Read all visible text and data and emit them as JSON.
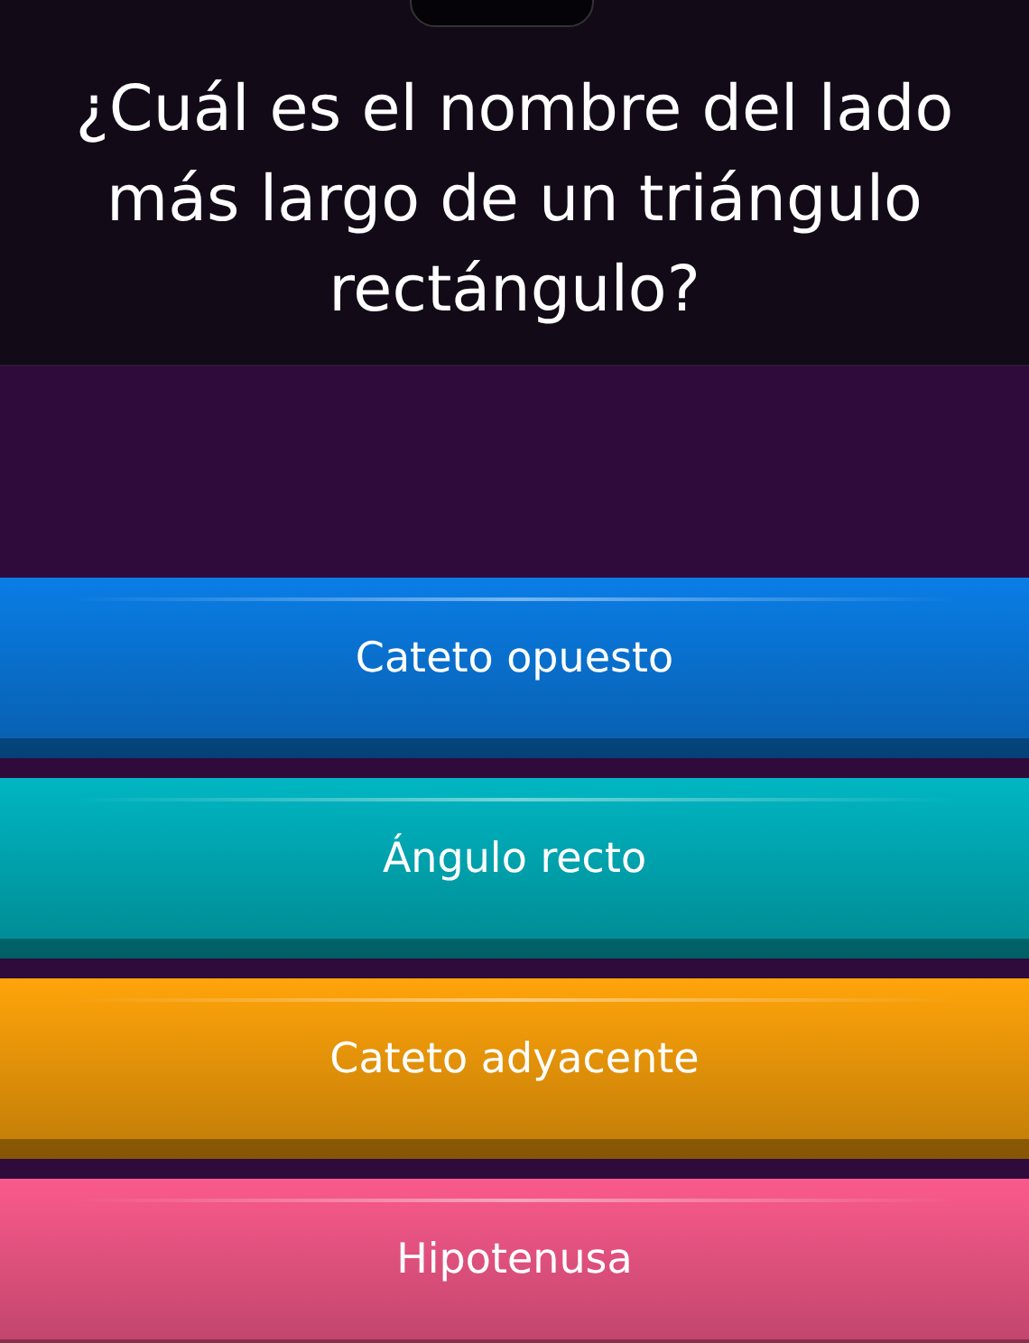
{
  "question": "¿Cuál es el nombre del lado más largo de un triángulo rectángulo?",
  "options": [
    {
      "label": "Cateto opuesto",
      "color": "#0a7de6"
    },
    {
      "label": "Ángulo recto",
      "color": "#00b6c2"
    },
    {
      "label": "Cateto adyacente",
      "color": "#ffa40a"
    },
    {
      "label": "Hipotenusa",
      "color": "#fa5a8c"
    }
  ]
}
